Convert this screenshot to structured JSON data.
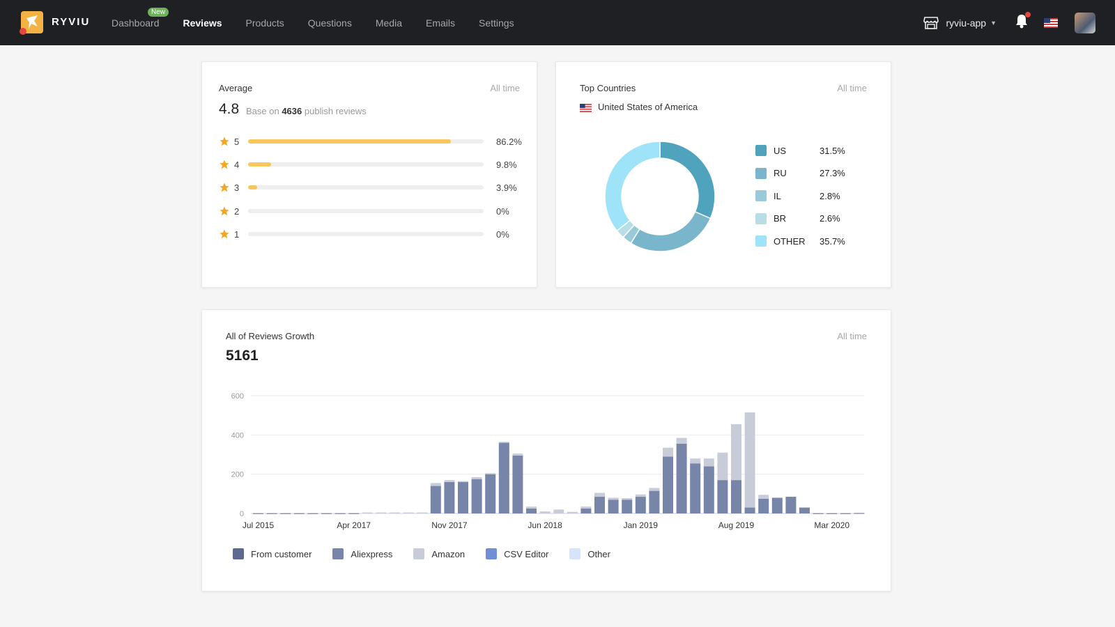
{
  "app": {
    "brand": "RYVIU",
    "nav": [
      {
        "label": "Dashboard",
        "badge": "New",
        "active": false
      },
      {
        "label": "Reviews",
        "active": true
      },
      {
        "label": "Products",
        "active": false
      },
      {
        "label": "Questions",
        "active": false
      },
      {
        "label": "Media",
        "active": false
      },
      {
        "label": "Emails",
        "active": false
      },
      {
        "label": "Settings",
        "active": false
      }
    ],
    "store_name": "ryviu-app",
    "icons": {
      "store": "store-icon",
      "bell": "bell-icon",
      "flag": "us-flag-icon",
      "avatar": "user-avatar"
    }
  },
  "average_card": {
    "title": "Average",
    "range": "All time",
    "value": "4.8",
    "sub_prefix": "Base on",
    "count": "4636",
    "sub_suffix": "publish reviews",
    "ratings": [
      {
        "stars": "5",
        "percent": 86.2,
        "label": "86.2%"
      },
      {
        "stars": "4",
        "percent": 9.8,
        "label": "9.8%"
      },
      {
        "stars": "3",
        "percent": 3.9,
        "label": "3.9%"
      },
      {
        "stars": "2",
        "percent": 0,
        "label": "0%"
      },
      {
        "stars": "1",
        "percent": 0,
        "label": "0%"
      }
    ],
    "star_color": "#f5a623",
    "bar_color": "#f7c75d"
  },
  "countries_card": {
    "title": "Top Countries",
    "range": "All time",
    "top_country": "United States of America",
    "slices": [
      {
        "code": "US",
        "value": 31.5,
        "label": "31.5%",
        "color": "#4fa3bc"
      },
      {
        "code": "RU",
        "value": 27.3,
        "label": "27.3%",
        "color": "#79b6cc"
      },
      {
        "code": "IL",
        "value": 2.8,
        "label": "2.8%",
        "color": "#98cad8"
      },
      {
        "code": "BR",
        "value": 2.6,
        "label": "2.6%",
        "color": "#b9dde7"
      },
      {
        "code": "OTHER",
        "value": 35.7,
        "label": "35.7%",
        "color": "#9ee3f8"
      }
    ]
  },
  "growth_card": {
    "title": "All of Reviews Growth",
    "range": "All time",
    "total": "5161"
  },
  "chart_data": [
    {
      "type": "pie",
      "title": "Top Countries",
      "categories": [
        "US",
        "RU",
        "IL",
        "BR",
        "OTHER"
      ],
      "values": [
        31.5,
        27.3,
        2.8,
        2.6,
        35.7
      ],
      "donut": true,
      "legend": "right"
    },
    {
      "type": "bar",
      "stacked": true,
      "title": "All of Reviews Growth",
      "ylim": [
        0,
        600
      ],
      "yticks": [
        0,
        200,
        400,
        600
      ],
      "xtick_labels": [
        {
          "index": 0,
          "label": "Jul 2015"
        },
        {
          "index": 7,
          "label": "Apr 2017"
        },
        {
          "index": 14,
          "label": "Nov 2017"
        },
        {
          "index": 21,
          "label": "Jun 2018"
        },
        {
          "index": 28,
          "label": "Jan 2019"
        },
        {
          "index": 35,
          "label": "Aug 2019"
        },
        {
          "index": 42,
          "label": "Mar 2020"
        }
      ],
      "grid": true,
      "legend": "bottom",
      "series": [
        {
          "name": "From customer",
          "color": "#5d6a8f",
          "values": [
            1,
            1,
            1,
            1,
            1,
            1,
            1,
            1,
            0,
            0,
            0,
            0,
            0,
            0,
            0,
            0,
            0,
            0,
            0,
            0,
            0,
            0,
            0,
            0,
            0,
            0,
            0,
            0,
            0,
            0,
            0,
            0,
            0,
            0,
            0,
            0,
            0,
            0,
            0,
            0,
            0,
            1,
            1,
            1,
            2
          ]
        },
        {
          "name": "Aliexpress",
          "color": "#7786a8",
          "values": [
            0,
            0,
            0,
            0,
            0,
            0,
            0,
            0,
            0,
            0,
            0,
            0,
            0,
            140,
            160,
            160,
            175,
            200,
            360,
            295,
            25,
            0,
            0,
            0,
            25,
            85,
            70,
            70,
            85,
            115,
            290,
            355,
            255,
            240,
            170,
            170,
            30,
            75,
            80,
            85,
            30,
            0,
            0,
            0,
            0
          ]
        },
        {
          "name": "Amazon",
          "color": "#c8ccd9",
          "values": [
            0,
            0,
            0,
            0,
            0,
            0,
            0,
            0,
            5,
            5,
            5,
            5,
            5,
            15,
            10,
            5,
            10,
            5,
            5,
            10,
            10,
            10,
            20,
            8,
            10,
            20,
            10,
            8,
            12,
            15,
            45,
            30,
            25,
            40,
            140,
            285,
            485,
            20,
            0,
            0,
            0,
            0,
            0,
            0,
            0
          ]
        },
        {
          "name": "CSV Editor",
          "color": "#6f8fd6",
          "values": [
            0,
            0,
            0,
            0,
            0,
            0,
            0,
            0,
            0,
            0,
            0,
            0,
            0,
            0,
            0,
            0,
            0,
            0,
            0,
            0,
            0,
            0,
            0,
            0,
            0,
            0,
            0,
            0,
            0,
            0,
            0,
            0,
            0,
            0,
            0,
            0,
            0,
            0,
            0,
            0,
            0,
            0,
            0,
            0,
            0
          ]
        },
        {
          "name": "Other",
          "color": "#d6e4fb",
          "values": [
            0,
            0,
            0,
            0,
            0,
            0,
            0,
            0,
            0,
            0,
            0,
            0,
            0,
            0,
            0,
            0,
            0,
            0,
            0,
            0,
            0,
            0,
            0,
            0,
            0,
            0,
            0,
            0,
            0,
            0,
            0,
            0,
            0,
            0,
            0,
            0,
            0,
            0,
            0,
            0,
            0,
            0,
            0,
            0,
            0
          ]
        }
      ]
    }
  ]
}
